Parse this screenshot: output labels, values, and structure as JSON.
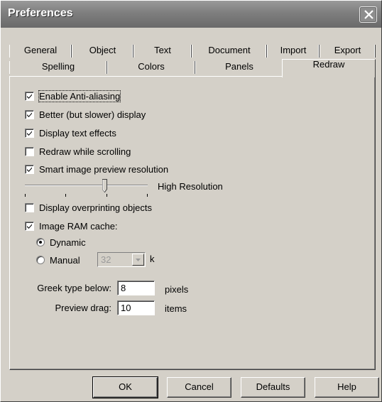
{
  "window": {
    "title": "Preferences"
  },
  "tabs": {
    "row1": [
      "General",
      "Object",
      "Text",
      "Document",
      "Import",
      "Export"
    ],
    "row2": [
      "Spelling",
      "Colors",
      "Panels"
    ],
    "active": "Redraw"
  },
  "options": {
    "anti_aliasing": {
      "label": "Enable Anti-aliasing",
      "checked": true
    },
    "better_display": {
      "label": "Better (but slower) display",
      "checked": true
    },
    "text_effects": {
      "label": "Display text effects",
      "checked": true
    },
    "redraw_scrolling": {
      "label": "Redraw while scrolling",
      "checked": false
    },
    "smart_preview": {
      "label": "Smart image preview resolution",
      "checked": true
    },
    "overprinting": {
      "label": "Display overprinting objects",
      "checked": false
    },
    "ram_cache": {
      "label": "Image RAM cache:",
      "checked": true
    }
  },
  "slider": {
    "label": "High Resolution",
    "value_fraction": 0.65
  },
  "cache_mode": {
    "dynamic_label": "Dynamic",
    "manual_label": "Manual",
    "selected": "Dynamic",
    "manual_value": "32",
    "unit": "k"
  },
  "greek": {
    "label": "Greek type below:",
    "value": "8",
    "unit": "pixels"
  },
  "preview_drag": {
    "label": "Preview drag:",
    "value": "10",
    "unit": "items"
  },
  "buttons": {
    "ok": "OK",
    "cancel": "Cancel",
    "defaults": "Defaults",
    "help": "Help"
  }
}
